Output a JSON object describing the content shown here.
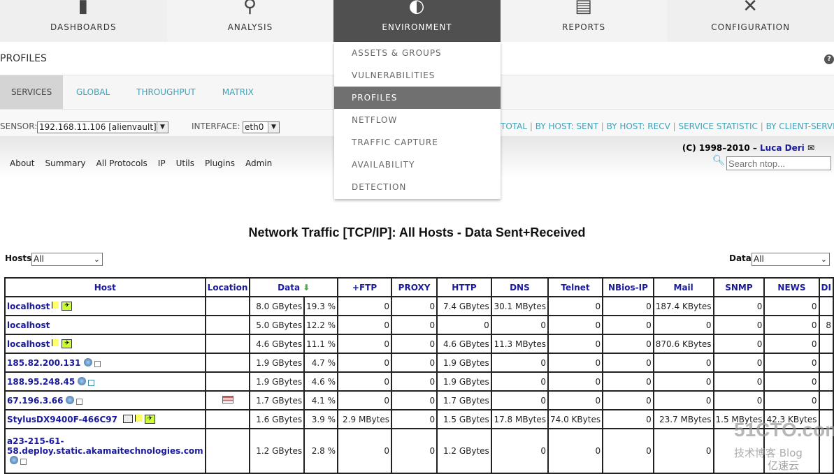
{
  "nav": [
    {
      "label": "DASHBOARDS",
      "icon": "bar-chart-icon",
      "glyph": "▮"
    },
    {
      "label": "ANALYSIS",
      "icon": "magnifier-chart-icon",
      "glyph": "⚲"
    },
    {
      "label": "ENVIRONMENT",
      "icon": "planet-icon",
      "glyph": "◐",
      "active": true
    },
    {
      "label": "REPORTS",
      "icon": "document-icon",
      "glyph": "▤"
    },
    {
      "label": "CONFIGURATION",
      "icon": "tools-icon",
      "glyph": "✕"
    }
  ],
  "menu": [
    "ASSETS & GROUPS",
    "VULNERABILITIES",
    "PROFILES",
    "NETFLOW",
    "TRAFFIC CAPTURE",
    "AVAILABILITY",
    "DETECTION"
  ],
  "menu_selected": "PROFILES",
  "page_title": "PROFILES",
  "help": "?",
  "subtabs": [
    "SERVICES",
    "GLOBAL",
    "THROUGHPUT",
    "MATRIX"
  ],
  "sensor": {
    "label": "SENSOR:",
    "value": "192.168.11.106 [alienvault]",
    "iface_label": "INTERFACE:",
    "iface_value": "eth0"
  },
  "links": [
    "TOTAL",
    "BY HOST: SENT",
    "BY HOST: RECV",
    "SERVICE STATISTIC",
    "BY CLIENT-SERVER"
  ],
  "ntop": {
    "copyright": "(C) 1998–2010 – ",
    "author": "Luca Deri",
    "search_placeholder": "Search ntop...",
    "menu": [
      "About",
      "Summary",
      "All Protocols",
      "IP",
      "Utils",
      "Plugins",
      "Admin"
    ]
  },
  "title": "Network Traffic [TCP/IP]: All Hosts - Data Sent+Received",
  "hosts_filter": {
    "label": "Hosts:",
    "value": "All"
  },
  "data_filter": {
    "label": "Data:",
    "value": "All"
  },
  "table": {
    "headers": [
      "Host",
      "Location",
      "Data",
      "+FTP",
      "PROXY",
      "HTTP",
      "DNS",
      "Telnet",
      "NBios-IP",
      "Mail",
      "SNMP",
      "NEWS",
      "DI"
    ],
    "rows": [
      {
        "host": "localhost",
        "icons": [
          "flag",
          "switch"
        ],
        "loc": "",
        "data": "8.0 GBytes",
        "pct": "19.3 %",
        "cells": [
          "0",
          "0",
          "7.4 GBytes",
          "30.1 MBytes",
          "0",
          "0",
          "187.4 KBytes",
          "0",
          "0",
          ""
        ]
      },
      {
        "host": "localhost",
        "icons": [],
        "loc": "",
        "data": "5.0 GBytes",
        "pct": "12.2 %",
        "cells": [
          "0",
          "0",
          "0",
          "0",
          "0",
          "0",
          "0",
          "0",
          "0",
          "8"
        ]
      },
      {
        "host": "localhost",
        "icons": [
          "flag",
          "switch"
        ],
        "loc": "",
        "data": "4.6 GBytes",
        "pct": "11.1 %",
        "cells": [
          "0",
          "0",
          "4.6 GBytes",
          "11.3 MBytes",
          "0",
          "0",
          "870.6 KBytes",
          "0",
          "0",
          ""
        ]
      },
      {
        "host": "185.82.200.131",
        "icons": [
          "globe",
          "link"
        ],
        "loc": "",
        "data": "1.9 GBytes",
        "pct": "4.7 %",
        "cells": [
          "0",
          "0",
          "1.9 GBytes",
          "0",
          "0",
          "0",
          "0",
          "0",
          "0",
          ""
        ]
      },
      {
        "host": "188.95.248.45",
        "icons": [
          "globe",
          "link"
        ],
        "loc": "",
        "data": "1.9 GBytes",
        "pct": "4.6 %",
        "cells": [
          "0",
          "0",
          "1.9 GBytes",
          "0",
          "0",
          "0",
          "0",
          "0",
          "0",
          ""
        ]
      },
      {
        "host": "67.196.3.66",
        "icons": [
          "globe",
          "link"
        ],
        "loc": "us-flag",
        "data": "1.7 GBytes",
        "pct": "4.1 %",
        "cells": [
          "0",
          "0",
          "1.7 GBytes",
          "0",
          "0",
          "0",
          "0",
          "0",
          "0",
          ""
        ]
      },
      {
        "host": "StylusDX9400F-466C97",
        "icons": [
          "printer",
          "flag",
          "switch"
        ],
        "loc": "",
        "data": "1.6 GBytes",
        "pct": "3.9 %",
        "cells": [
          "2.9 MBytes",
          "0",
          "1.5 GBytes",
          "17.8 MBytes",
          "74.0 KBytes",
          "0",
          "23.7 MBytes",
          "1.5 MBytes",
          "42.3 KBytes",
          ""
        ]
      },
      {
        "host": "a23-215-61-58.deploy.static.akamaitechnologies.com",
        "icons": [
          "globe",
          "link"
        ],
        "loc": "",
        "data": "1.2 GBytes",
        "pct": "2.8 %",
        "cells": [
          "0",
          "0",
          "1.2 GBytes",
          "0",
          "0",
          "0",
          "0",
          "",
          "",
          ""
        ]
      }
    ]
  },
  "watermark": [
    "51CTO.com",
    "技术博客 Blog",
    "亿速云"
  ]
}
